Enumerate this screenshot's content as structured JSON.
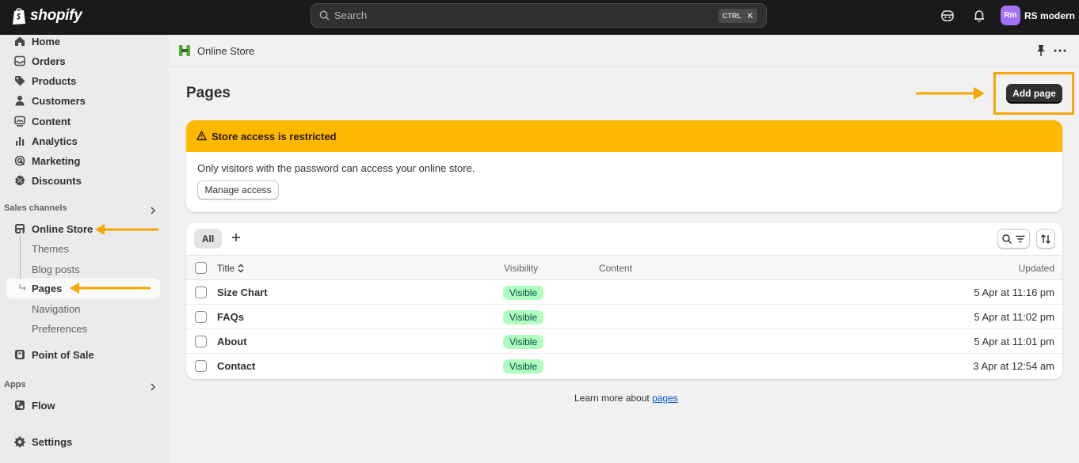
{
  "topbar": {
    "logo_text": "shopify",
    "search_placeholder": "Search",
    "shortcut_ctrl": "CTRL",
    "shortcut_k": "K",
    "store_initials": "Rm",
    "store_name": "RS modern"
  },
  "sidebar": {
    "items": [
      {
        "label": "Home",
        "icon": "home-icon"
      },
      {
        "label": "Orders",
        "icon": "orders-icon"
      },
      {
        "label": "Products",
        "icon": "tag-icon"
      },
      {
        "label": "Customers",
        "icon": "person-icon"
      },
      {
        "label": "Content",
        "icon": "content-icon"
      },
      {
        "label": "Analytics",
        "icon": "chart-icon"
      },
      {
        "label": "Marketing",
        "icon": "target-icon"
      },
      {
        "label": "Discounts",
        "icon": "discount-icon"
      }
    ],
    "sales_channels_label": "Sales channels",
    "online_store": "Online Store",
    "sub_items": [
      "Themes",
      "Blog posts",
      "Pages",
      "Navigation",
      "Preferences"
    ],
    "point_of_sale": "Point of Sale",
    "apps_label": "Apps",
    "flow": "Flow",
    "settings": "Settings"
  },
  "main": {
    "breadcrumb": "Online Store",
    "title": "Pages",
    "add_button": "Add page",
    "banner": {
      "title": "Store access is restricted",
      "text": "Only visitors with the password can access your online store.",
      "button": "Manage access"
    },
    "tabs": [
      "All"
    ],
    "table": {
      "columns": {
        "title": "Title",
        "visibility": "Visibility",
        "content": "Content",
        "updated": "Updated"
      },
      "rows": [
        {
          "title": "Size Chart",
          "visibility": "Visible",
          "updated": "5 Apr at 11:16 pm"
        },
        {
          "title": "FAQs",
          "visibility": "Visible",
          "updated": "5 Apr at 11:02 pm"
        },
        {
          "title": "About",
          "visibility": "Visible",
          "updated": "5 Apr at 11:01 pm"
        },
        {
          "title": "Contact",
          "visibility": "Visible",
          "updated": "3 Apr at 12:54 am"
        }
      ]
    },
    "learn_more_prefix": "Learn more about ",
    "learn_more_link": "pages"
  },
  "colors": {
    "topbar": "#1a1a1a",
    "banner": "#ffb800",
    "badge_bg": "#affebf",
    "annotation": "#f7a700",
    "link": "#005bd3"
  }
}
